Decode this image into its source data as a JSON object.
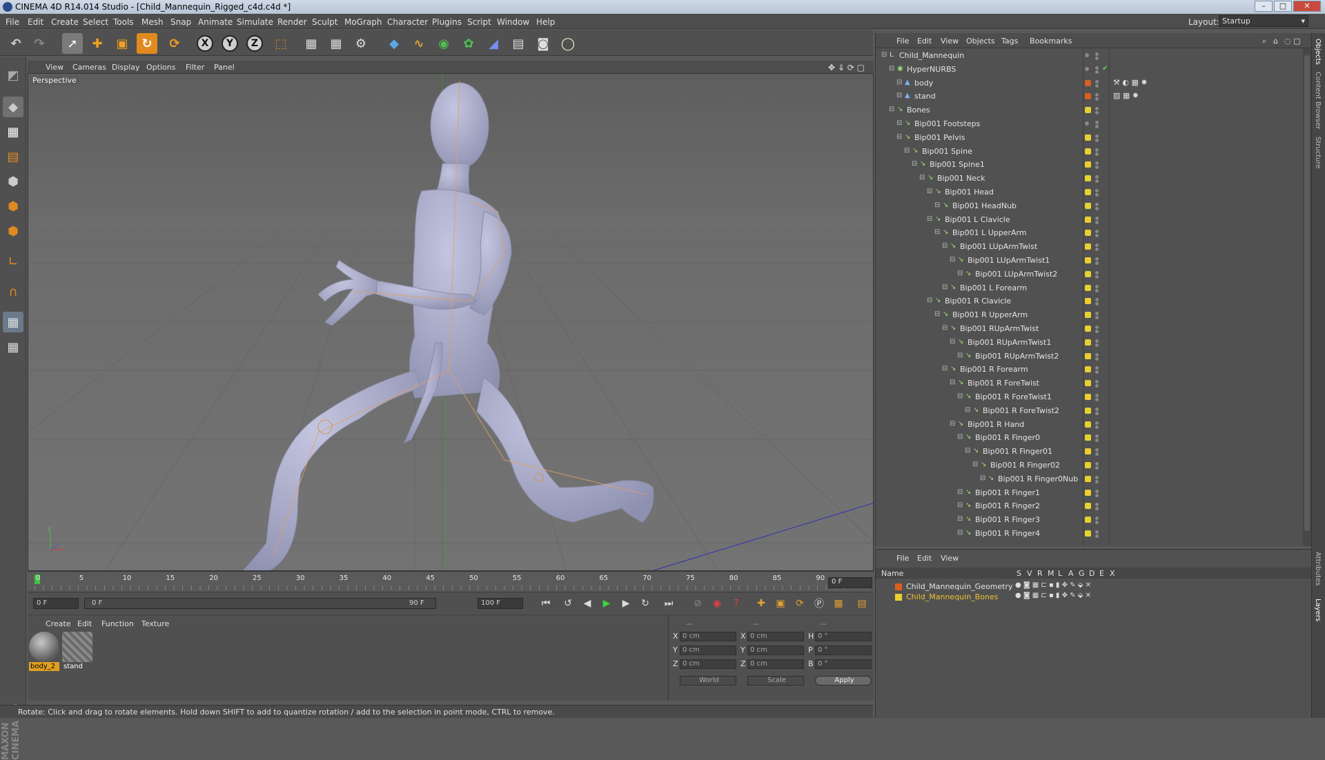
{
  "window": {
    "title": "CINEMA 4D R14.014 Studio - [Child_Mannequin_Rigged_c4d.c4d *]"
  },
  "menubar": {
    "items": [
      "File",
      "Edit",
      "Create",
      "Select",
      "Tools",
      "Mesh",
      "Snap",
      "Animate",
      "Simulate",
      "Render",
      "Sculpt",
      "MoGraph",
      "Character",
      "Plugins",
      "Script",
      "Window",
      "Help"
    ],
    "layout_label": "Layout:",
    "layout_value": "Startup"
  },
  "viewport": {
    "menu": [
      "View",
      "Cameras",
      "Display",
      "Options",
      "Filter",
      "Panel"
    ],
    "camera_label": "Perspective"
  },
  "timeline": {
    "ticks": [
      "0",
      "5",
      "10",
      "15",
      "20",
      "25",
      "30",
      "35",
      "40",
      "45",
      "50",
      "55",
      "60",
      "65",
      "70",
      "75",
      "80",
      "85",
      "90"
    ],
    "current_frame": "0 F"
  },
  "transport": {
    "start_frame": "0 F",
    "range_start": "0 F",
    "range_end": "90 F",
    "end_frame": "100 F"
  },
  "materials": {
    "menu": [
      "Create",
      "Edit",
      "Function",
      "Texture"
    ],
    "items": [
      {
        "label": "body_2",
        "selected": true
      },
      {
        "label": "stand",
        "selected": false
      }
    ]
  },
  "coords": {
    "header": [
      "--",
      "--",
      "--"
    ],
    "rows": [
      {
        "a_label": "X",
        "a_val": "0 cm",
        "b_label": "X",
        "b_val": "0 cm",
        "c_label": "H",
        "c_val": "0 °"
      },
      {
        "a_label": "Y",
        "a_val": "0 cm",
        "b_label": "Y",
        "b_val": "0 cm",
        "c_label": "P",
        "c_val": "0 °"
      },
      {
        "a_label": "Z",
        "a_val": "0 cm",
        "b_label": "Z",
        "b_val": "0 cm",
        "c_label": "B",
        "c_val": "0 °"
      }
    ],
    "space": "World",
    "mode": "Scale",
    "apply_label": "Apply"
  },
  "status": {
    "text": "Rotate: Click and drag to rotate elements. Hold down SHIFT to add to quantize rotation / add to the selection in point mode, CTRL to remove."
  },
  "objects": {
    "menu": [
      "File",
      "Edit",
      "View",
      "Objects",
      "Tags",
      "Bookmarks"
    ],
    "tree": [
      {
        "name": "Child_Mannequin",
        "depth": 0,
        "color": "#888888"
      },
      {
        "name": "HyperNURBS",
        "depth": 1,
        "color": "#888888"
      },
      {
        "name": "body",
        "depth": 2,
        "color": "#d86020"
      },
      {
        "name": "stand",
        "depth": 2,
        "color": "#d86020"
      },
      {
        "name": "Bones",
        "depth": 1,
        "color": "#e8d030"
      },
      {
        "name": "Bip001 Footsteps",
        "depth": 2,
        "color": "#888888"
      },
      {
        "name": "Bip001 Pelvis",
        "depth": 2,
        "color": "#e8d030"
      },
      {
        "name": "Bip001 Spine",
        "depth": 3,
        "color": "#e8d030"
      },
      {
        "name": "Bip001 Spine1",
        "depth": 4,
        "color": "#e8d030"
      },
      {
        "name": "Bip001 Neck",
        "depth": 5,
        "color": "#e8d030"
      },
      {
        "name": "Bip001 Head",
        "depth": 6,
        "color": "#e8d030"
      },
      {
        "name": "Bip001 HeadNub",
        "depth": 7,
        "color": "#e8d030"
      },
      {
        "name": "Bip001 L Clavicle",
        "depth": 6,
        "color": "#e8d030"
      },
      {
        "name": "Bip001 L UpperArm",
        "depth": 7,
        "color": "#e8d030"
      },
      {
        "name": "Bip001 LUpArmTwist",
        "depth": 8,
        "color": "#e8d030"
      },
      {
        "name": "Bip001 LUpArmTwist1",
        "depth": 9,
        "color": "#e8d030"
      },
      {
        "name": "Bip001 LUpArmTwist2",
        "depth": 10,
        "color": "#e8d030"
      },
      {
        "name": "Bip001 L Forearm",
        "depth": 8,
        "color": "#e8d030"
      },
      {
        "name": "Bip001 R Clavicle",
        "depth": 6,
        "color": "#e8d030"
      },
      {
        "name": "Bip001 R UpperArm",
        "depth": 7,
        "color": "#e8d030"
      },
      {
        "name": "Bip001 RUpArmTwist",
        "depth": 8,
        "color": "#e8d030"
      },
      {
        "name": "Bip001 RUpArmTwist1",
        "depth": 9,
        "color": "#e8d030"
      },
      {
        "name": "Bip001 RUpArmTwist2",
        "depth": 10,
        "color": "#e8d030"
      },
      {
        "name": "Bip001 R Forearm",
        "depth": 8,
        "color": "#e8d030"
      },
      {
        "name": "Bip001 R ForeTwist",
        "depth": 9,
        "color": "#e8d030"
      },
      {
        "name": "Bip001 R ForeTwist1",
        "depth": 10,
        "color": "#e8d030"
      },
      {
        "name": "Bip001 R ForeTwist2",
        "depth": 11,
        "color": "#e8d030"
      },
      {
        "name": "Bip001 R Hand",
        "depth": 9,
        "color": "#e8d030"
      },
      {
        "name": "Bip001 R Finger0",
        "depth": 10,
        "color": "#e8d030"
      },
      {
        "name": "Bip001 R Finger01",
        "depth": 11,
        "color": "#e8d030"
      },
      {
        "name": "Bip001 R Finger02",
        "depth": 12,
        "color": "#e8d030"
      },
      {
        "name": "Bip001 R Finger0Nub",
        "depth": 13,
        "color": "#e8d030"
      },
      {
        "name": "Bip001 R Finger1",
        "depth": 10,
        "color": "#e8d030"
      },
      {
        "name": "Bip001 R Finger2",
        "depth": 10,
        "color": "#e8d030"
      },
      {
        "name": "Bip001 R Finger3",
        "depth": 10,
        "color": "#e8d030"
      },
      {
        "name": "Bip001 R Finger4",
        "depth": 10,
        "color": "#e8d030"
      }
    ]
  },
  "layers": {
    "menu": [
      "File",
      "Edit",
      "View"
    ],
    "columns": {
      "name": "Name",
      "flags": [
        "S",
        "V",
        "R",
        "M",
        "L",
        "A",
        "G",
        "D",
        "E",
        "X"
      ]
    },
    "rows": [
      {
        "name": "Child_Mannequin_Geometry",
        "color": "#d86020",
        "text_color": "#e4e4e4"
      },
      {
        "name": "Child_Mannequin_Bones",
        "color": "#e8d030",
        "text_color": "#f0c030"
      }
    ]
  },
  "right_tabs": [
    "Objects",
    "Content Browser",
    "Structure",
    "Attributes",
    "Layers"
  ],
  "logo": "MAXON CINEMA 4D"
}
